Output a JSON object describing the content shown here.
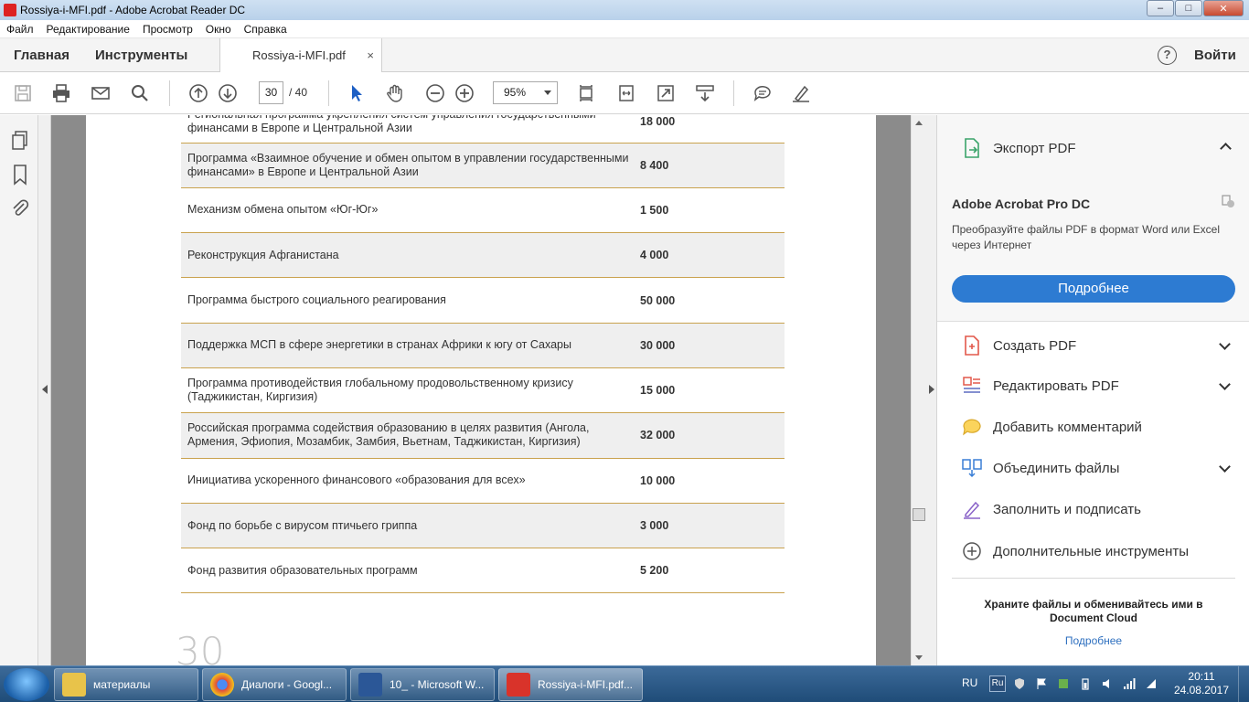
{
  "window": {
    "title": "Rossiya-i-MFI.pdf - Adobe Acrobat Reader DC",
    "minimize": "–",
    "maximize": "□",
    "close": "✕"
  },
  "menu": [
    "Файл",
    "Редактирование",
    "Просмотр",
    "Окно",
    "Справка"
  ],
  "tabs": {
    "home": "Главная",
    "tools": "Инструменты",
    "document": "Rossiya-i-MFI.pdf",
    "close": "×",
    "help": "?",
    "login": "Войти"
  },
  "toolbar": {
    "icons": [
      "save-icon",
      "print-icon",
      "mail-icon",
      "search-icon",
      "page-up-icon",
      "page-down-icon",
      "select-arrow-icon",
      "hand-icon",
      "zoom-out-icon",
      "zoom-in-icon",
      "fit-page-icon",
      "full-screen-icon",
      "scroll-mode-icon",
      "comment-icon",
      "highlight-icon"
    ],
    "page_current": "30",
    "page_total": "/ 40",
    "zoom": "95%"
  },
  "table": {
    "rows": [
      {
        "name": "Региональная программа укрепления систем управления государственными финансами в Европе и Центральной Азии",
        "value": "18 000"
      },
      {
        "name": "Программа «Взаимное обучение и обмен опытом в управлении государственными финансами» в Европе и Центральной Азии",
        "value": "8 400"
      },
      {
        "name": "Механизм обмена опытом «Юг-Юг»",
        "value": "1 500"
      },
      {
        "name": "Реконструкция Афганистана",
        "value": "4 000"
      },
      {
        "name": "Программа быстрого социального реагирования",
        "value": "50 000"
      },
      {
        "name": "Поддержка МСП в сфере энергетики в странах Африки к югу от Сахары",
        "value": "30 000"
      },
      {
        "name": "Программа противодействия глобальному продовольственному кризису (Таджикистан, Киргизия)",
        "value": "15 000"
      },
      {
        "name": "Российская программа содействия образованию в целях развития (Ангола, Армения, Эфиопия, Мозамбик, Замбия, Вьетнам, Таджикистан, Киргизия)",
        "value": "32 000"
      },
      {
        "name": "Инициатива ускоренного финансового «образования для всех»",
        "value": "10 000"
      },
      {
        "name": "Фонд по борьбе с вирусом птичьего гриппа",
        "value": "3 000"
      },
      {
        "name": "Фонд развития образовательных программ",
        "value": "5 200"
      }
    ],
    "page_number": "30"
  },
  "right_panel": {
    "export": "Экспорт PDF",
    "acrobat_title": "Adobe Acrobat Pro DC",
    "acrobat_desc": "Преобразуйте файлы PDF в формат Word или Excel через Интернет",
    "more_button": "Подробнее",
    "tools": [
      {
        "label": "Создать PDF",
        "icon": "create-pdf-icon",
        "chevron": true
      },
      {
        "label": "Редактировать PDF",
        "icon": "edit-pdf-icon",
        "chevron": true
      },
      {
        "label": "Добавить комментарий",
        "icon": "comment-icon",
        "chevron": false
      },
      {
        "label": "Объединить файлы",
        "icon": "combine-files-icon",
        "chevron": true
      },
      {
        "label": "Заполнить и подписать",
        "icon": "sign-icon",
        "chevron": false
      },
      {
        "label": "Дополнительные инструменты",
        "icon": "more-tools-icon",
        "chevron": false
      }
    ],
    "cloud_text": "Храните файлы и обменивайтесь ими в Document Cloud",
    "cloud_link": "Подробнее"
  },
  "taskbar": {
    "tasks": [
      {
        "label": "материалы",
        "icon": "folder-icon",
        "color": "#e8c34a"
      },
      {
        "label": "Диалоги - Googl...",
        "icon": "chrome-icon",
        "color": "#e04a3c"
      },
      {
        "label": "10_ - Microsoft W...",
        "icon": "word-icon",
        "color": "#2b5797"
      },
      {
        "label": "Rossiya-i-MFI.pdf...",
        "icon": "pdf-icon",
        "color": "#d9332a"
      }
    ],
    "lang": "RU",
    "ime": "Ru",
    "time": "20:11",
    "date": "24.08.2017"
  },
  "colors": {
    "accent": "#2d7bd2",
    "table_rule": "#c9a24e",
    "row_shade": "#efefef"
  }
}
